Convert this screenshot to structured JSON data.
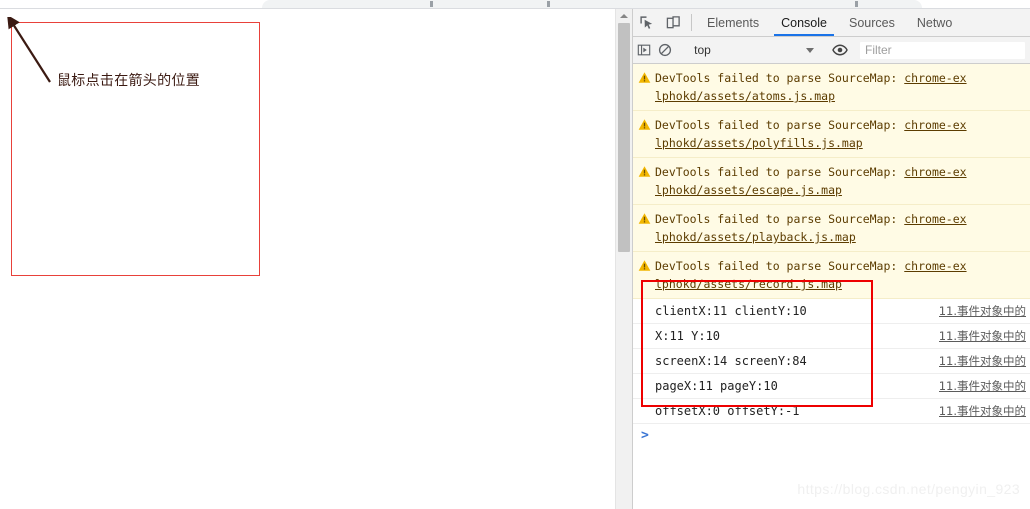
{
  "browser": {
    "tab_strip_label": ""
  },
  "page": {
    "annotation_label": "鼠标点击在箭头的位置",
    "box_border_color": "#e8413a",
    "arrow_color": "#3b1a12"
  },
  "scrollbar": {
    "up_arrow_icon": "scroll-up-arrow-icon"
  },
  "devtools": {
    "toolbar_icons": [
      {
        "name": "inspect-element-icon"
      },
      {
        "name": "device-toolbar-icon"
      }
    ],
    "tabs": [
      {
        "label": "Elements",
        "active": false
      },
      {
        "label": "Console",
        "active": true
      },
      {
        "label": "Sources",
        "active": false
      },
      {
        "label": "Netwo",
        "active": false
      }
    ],
    "active_tab_underline_color": "#1a73e8",
    "console_toolbar": {
      "sidebar_toggle_icon": "console-sidebar-toggle-icon",
      "clear_console_icon": "clear-console-icon",
      "context_value": "top",
      "eye_icon": "live-expression-eye-icon",
      "filter_value": "",
      "filter_placeholder": "Filter"
    },
    "warnings": [
      {
        "icon": "warning-triangle-icon",
        "line1_text": "DevTools failed to parse SourceMap: ",
        "line1_link": "chrome-ex",
        "line2_link": "lphokd/assets/atoms.js.map"
      },
      {
        "icon": "warning-triangle-icon",
        "line1_text": "DevTools failed to parse SourceMap: ",
        "line1_link": "chrome-ex",
        "line2_link": "lphokd/assets/polyfills.js.map"
      },
      {
        "icon": "warning-triangle-icon",
        "line1_text": "DevTools failed to parse SourceMap: ",
        "line1_link": "chrome-ex",
        "line2_link": "lphokd/assets/escape.js.map"
      },
      {
        "icon": "warning-triangle-icon",
        "line1_text": "DevTools failed to parse SourceMap: ",
        "line1_link": "chrome-ex",
        "line2_link": "lphokd/assets/playback.js.map"
      },
      {
        "icon": "warning-triangle-icon",
        "line1_text": "DevTools failed to parse SourceMap: ",
        "line1_link": "chrome-ex",
        "line2_link": "lphokd/assets/record.js.map"
      }
    ],
    "logs": [
      {
        "text": "clientX:11 clientY:10",
        "source": "11.事件对象中的"
      },
      {
        "text": "X:11 Y:10",
        "source": "11.事件对象中的"
      },
      {
        "text": "screenX:14 screenY:84",
        "source": "11.事件对象中的"
      },
      {
        "text": "pageX:11 pageY:10",
        "source": "11.事件对象中的"
      },
      {
        "text": "offsetX:0 offsetY:-1",
        "source": "11.事件对象中的"
      }
    ],
    "prompt_symbol": ">",
    "highlight_box_color": "#ee0000"
  },
  "watermark": {
    "text": "https://blog.csdn.net/pengyin_923"
  }
}
